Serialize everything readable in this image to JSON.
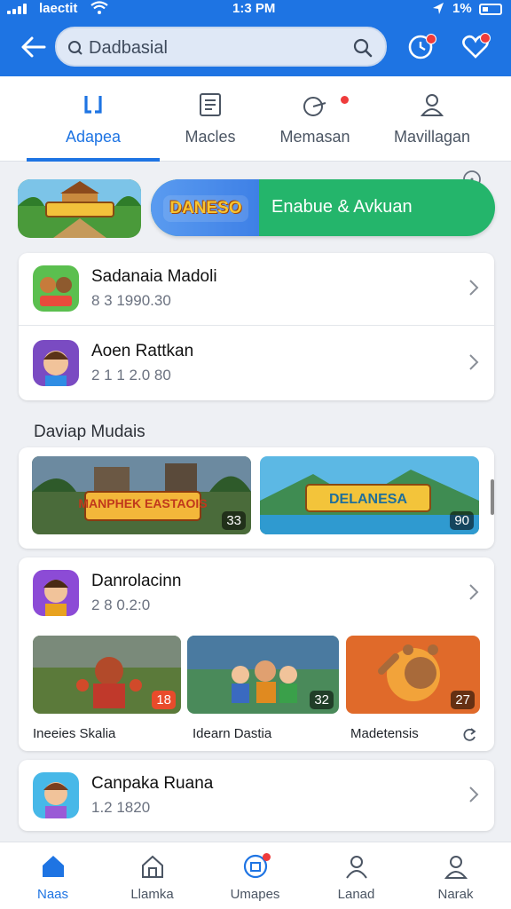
{
  "status_bar": {
    "carrier": "laectit",
    "time": "1:3 PM",
    "battery": "1%"
  },
  "header": {
    "search_placeholder": "Dadbasial"
  },
  "tabs": [
    {
      "label": "Adapea",
      "icon": "code-brackets-icon",
      "active": true
    },
    {
      "label": "Macles",
      "icon": "document-icon",
      "active": false
    },
    {
      "label": "Memasan",
      "icon": "pen-icon",
      "active": false
    },
    {
      "label": "Mavillagan",
      "icon": "user-icon",
      "active": false
    }
  ],
  "banner": {
    "logo_text": "DANESO",
    "pill_text": "Enabue & Avkuan"
  },
  "top_list": [
    {
      "title": "Sadanaia Madoli",
      "subtitle": "8 3 1990.30"
    },
    {
      "title": "Aoen Rattkan",
      "subtitle": "2 1 1 2.0 80"
    }
  ],
  "section": {
    "title": "Daviap Mudais",
    "thumbs": [
      {
        "title": "MANPHEK EASTAOIS",
        "badge": "33"
      },
      {
        "title": "DELANESA",
        "badge": "90"
      }
    ]
  },
  "feature_item": {
    "title": "Danrolacinn",
    "subtitle": "2 8 0.2:0"
  },
  "feature_thumbs": [
    {
      "label": "Ineeies Skalia",
      "badge": "18"
    },
    {
      "label": "Idearn Dastia",
      "badge": "32"
    },
    {
      "label": "Madetensis",
      "badge": "27"
    }
  ],
  "bottom_item": {
    "title": "Canpaka Ruana",
    "subtitle": "1.2 1820"
  },
  "bottom_nav": [
    {
      "label": "Naas",
      "icon": "home-icon",
      "active": true
    },
    {
      "label": "Llamka",
      "icon": "house-outline-icon",
      "active": false
    },
    {
      "label": "Umapes",
      "icon": "camera-icon",
      "active": false
    },
    {
      "label": "Lanad",
      "icon": "person-icon",
      "active": false
    },
    {
      "label": "Narak",
      "icon": "profile-icon",
      "active": false
    }
  ],
  "colors": {
    "primary": "#1e74e3",
    "accent_green": "#24b56b",
    "notification": "#ef3b3b"
  }
}
